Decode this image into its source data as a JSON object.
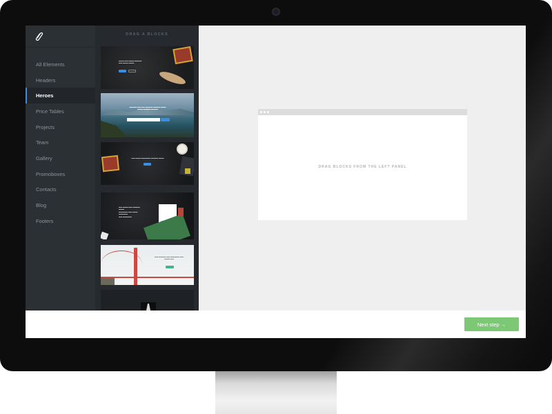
{
  "sidebar": {
    "items": [
      {
        "label": "All Elements",
        "active": false
      },
      {
        "label": "Headers",
        "active": false
      },
      {
        "label": "Heroes",
        "active": true
      },
      {
        "label": "Price Tables",
        "active": false
      },
      {
        "label": "Projects",
        "active": false
      },
      {
        "label": "Team",
        "active": false
      },
      {
        "label": "Gallery",
        "active": false
      },
      {
        "label": "Promoboxes",
        "active": false
      },
      {
        "label": "Contacts",
        "active": false
      },
      {
        "label": "Blog",
        "active": false
      },
      {
        "label": "Footers",
        "active": false
      }
    ]
  },
  "blocks_panel": {
    "title": "DRAG A BLOCKS"
  },
  "canvas": {
    "placeholder": "DRAG BLOCKS FROM THE LEFT PANEL"
  },
  "footer": {
    "next_label": "Next step →"
  },
  "colors": {
    "sidebar_bg": "#2b3035",
    "panel_bg": "#262a2e",
    "active_indicator": "#3a8de0",
    "canvas_bg": "#efefef",
    "next_button": "#7dc874"
  }
}
